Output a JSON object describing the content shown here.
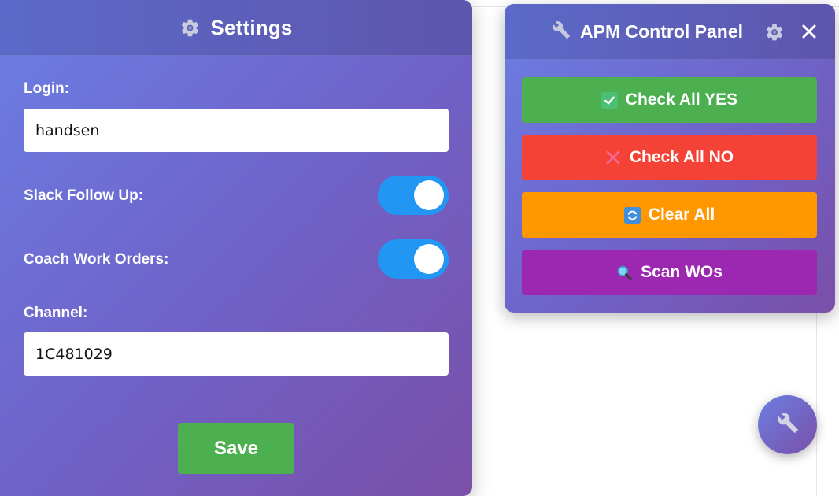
{
  "settings": {
    "title": "Settings",
    "login_label": "Login:",
    "login_value": "handsen",
    "slack_follow_up_label": "Slack Follow Up:",
    "slack_follow_up_enabled": true,
    "coach_work_orders_label": "Coach Work Orders:",
    "coach_work_orders_enabled": true,
    "channel_label": "Channel:",
    "channel_value": "1C481029",
    "save_label": "Save"
  },
  "apm_panel": {
    "title": "APM Control Panel",
    "buttons": [
      {
        "label": "Check All YES",
        "icon": "check-mark-icon",
        "color": "#4caf50"
      },
      {
        "label": "Check All NO",
        "icon": "cross-mark-icon",
        "color": "#f44336"
      },
      {
        "label": "Clear All",
        "icon": "refresh-icon",
        "color": "#ff9800"
      },
      {
        "label": "Scan WOs",
        "icon": "magnifier-icon",
        "color": "#9c27b0"
      }
    ]
  },
  "colors": {
    "panel_gradient_start": "#6b7fe3",
    "panel_gradient_end": "#7a4fa8",
    "toggle_on": "#2196f3",
    "save_button": "#4caf50"
  }
}
